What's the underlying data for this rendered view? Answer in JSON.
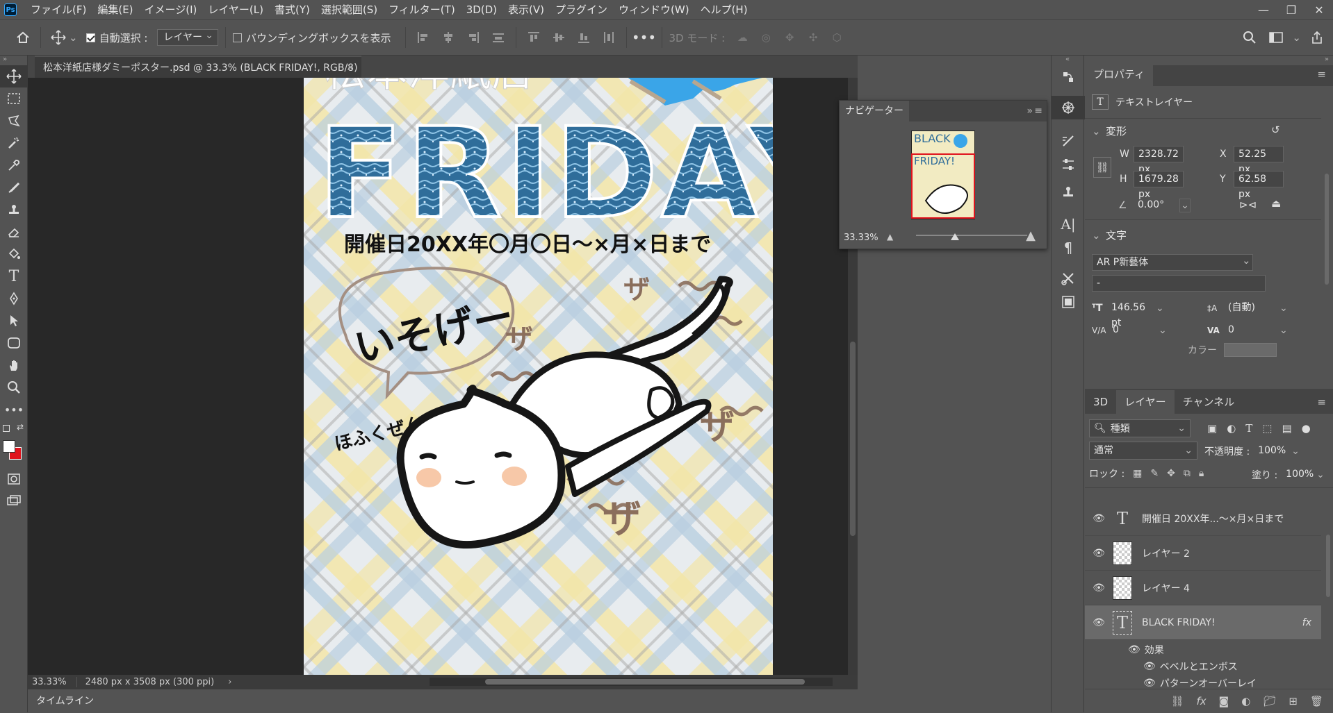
{
  "menu": [
    "ファイル(F)",
    "編集(E)",
    "イメージ(I)",
    "レイヤー(L)",
    "書式(Y)",
    "選択範囲(S)",
    "フィルター(T)",
    "3D(D)",
    "表示(V)",
    "プラグイン",
    "ウィンドウ(W)",
    "ヘルプ(H)"
  ],
  "app_logo": "Ps",
  "options": {
    "auto_select_label": "自動選択 :",
    "auto_select_value": "レイヤー",
    "bbox_label": "バウンディングボックスを表示",
    "mode3d_label": "3D モード :"
  },
  "document": {
    "tab_title": "松本洋紙店様ダミーポスター.psd @ 33.3% (BLACK FRIDAY!, RGB/8)",
    "zoom": "33.33%",
    "size_info": "2480 px x 3508 px (300 ppi)",
    "poster": {
      "headline": "FRIDAY!",
      "date_line": "開催日20XX年〇月〇日〜×月×日まで",
      "bubble_text": "いそげー",
      "side_text": "ほふくぜんしん",
      "sfx": [
        "ザ",
        "ザ",
        "ザ",
        "ザ"
      ]
    }
  },
  "timeline_label": "タイムライン",
  "navigator": {
    "title": "ナビゲーター",
    "zoom": "33.33%",
    "thumb_text1": "BLACK",
    "thumb_text2": "FRIDAY!"
  },
  "properties": {
    "tab": "プロパティ",
    "layer_kind": "テキストレイヤー",
    "transform_title": "変形",
    "w_label": "W",
    "w": "2328.72 px",
    "h_label": "H",
    "h": "1679.28 px",
    "x_label": "X",
    "x": "52.25 px",
    "y_label": "Y",
    "y": "62.58 px",
    "angle": "0.00°",
    "text_title": "文字",
    "font": "AR P新藝体",
    "style": "-",
    "size": "146.56 pt",
    "leading": "(自動)",
    "kerning": "0",
    "tracking": "0",
    "color_label": "カラー"
  },
  "layers_panel": {
    "tabs": [
      "3D",
      "レイヤー",
      "チャンネル"
    ],
    "filter_label": "種類",
    "blend_mode": "通常",
    "opacity_label": "不透明度 :",
    "opacity": "100%",
    "lock_label": "ロック :",
    "fill_label": "塗り :",
    "fill": "100%",
    "layers": [
      {
        "name": "開催日 20XX年...〜×月×日まで",
        "kind": "text"
      },
      {
        "name": "レイヤー 2",
        "kind": "pixel"
      },
      {
        "name": "レイヤー 4",
        "kind": "pixel"
      },
      {
        "name": "BLACK FRIDAY!",
        "kind": "text",
        "selected": true
      }
    ],
    "effects_label": "効果",
    "effects": [
      "ベベルとエンボス",
      "パターンオーバーレイ"
    ],
    "fx_badge": "fx"
  },
  "colors": {
    "foreground": "#ffffff",
    "background": "#e0131d",
    "accent_blue": "#31a8ff"
  }
}
